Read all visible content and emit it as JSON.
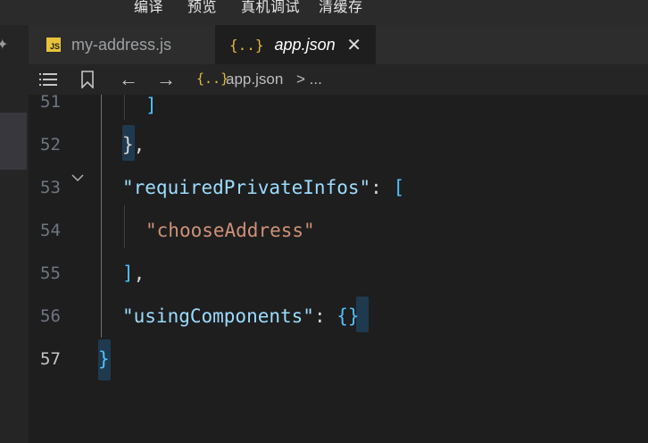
{
  "toolbar": {
    "items": [
      "编译",
      "预览",
      "真机调试",
      "清缓存"
    ]
  },
  "tabs": [
    {
      "label": "my-address.js",
      "icon": "js-file-icon"
    },
    {
      "label": "app.json",
      "icon": "json-file-icon",
      "active": true
    }
  ],
  "breadcrumb": {
    "file": "app.json",
    "separator": ">",
    "tail": "..."
  },
  "editor": {
    "line_numbers": [
      "51",
      "52",
      "53",
      "54",
      "55",
      "56",
      "57"
    ],
    "current_line": "57",
    "code": {
      "l51": "]",
      "l52_brace": "}",
      "l52_comma": ",",
      "l53_key": "\"requiredPrivateInfos\"",
      "l53_colon": ": ",
      "l53_bracket": "[",
      "l54_q1": "\"",
      "l54_str": "chooseAddress",
      "l54_q2": "\"",
      "l55_bracket": "]",
      "l55_comma": ",",
      "l56_key": "\"usingComponents\"",
      "l56_colon": ": ",
      "l56_obj": "{}",
      "l57": "}"
    }
  },
  "colors": {
    "background": "#1e1e1e",
    "key": "#9cdcfe",
    "string": "#ce9178",
    "bracket": "#4fc1ff"
  }
}
